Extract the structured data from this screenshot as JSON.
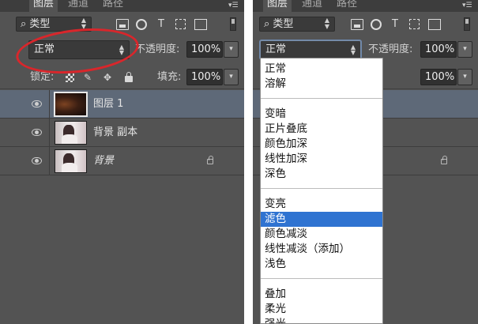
{
  "left_panel": {
    "tabs": [
      {
        "label": "图层",
        "active": true
      },
      {
        "label": "通道",
        "active": false
      },
      {
        "label": "路径",
        "active": false
      }
    ],
    "filter": {
      "icon": "search-icon",
      "label": "类型"
    },
    "blend_mode": "正常",
    "opacity": {
      "label": "不透明度:",
      "value": "100%"
    },
    "lock": {
      "label": "锁定:"
    },
    "fill": {
      "label": "填充:",
      "value": "100%"
    },
    "layers": [
      {
        "name": "图层 1",
        "selected": true,
        "locked": false
      },
      {
        "name": "背景 副本",
        "selected": false,
        "locked": false
      },
      {
        "name": "背景",
        "selected": false,
        "locked": true
      }
    ]
  },
  "right_panel": {
    "tabs": [
      {
        "label": "图层",
        "active": true
      },
      {
        "label": "通道",
        "active": false
      },
      {
        "label": "路径",
        "active": false
      }
    ],
    "filter": {
      "icon": "search-icon",
      "label": "类型"
    },
    "blend_mode": "正常",
    "opacity": {
      "label": "不透明度:",
      "value": "100%"
    },
    "fill": {
      "value": "100%"
    }
  },
  "blend_menu": {
    "groups": [
      [
        "正常",
        "溶解"
      ],
      [
        "变暗",
        "正片叠底",
        "颜色加深",
        "线性加深",
        "深色"
      ],
      [
        "变亮",
        "滤色",
        "颜色减淡",
        "线性减淡（添加）",
        "浅色"
      ],
      [
        "叠加",
        "柔光",
        "强光"
      ]
    ],
    "selected": "滤色"
  },
  "annotation": {
    "color": "#d9262b"
  },
  "colors": {
    "panel_bg": "#535353",
    "selected_layer": "#5e6978",
    "menu_highlight": "#2f73d1"
  }
}
